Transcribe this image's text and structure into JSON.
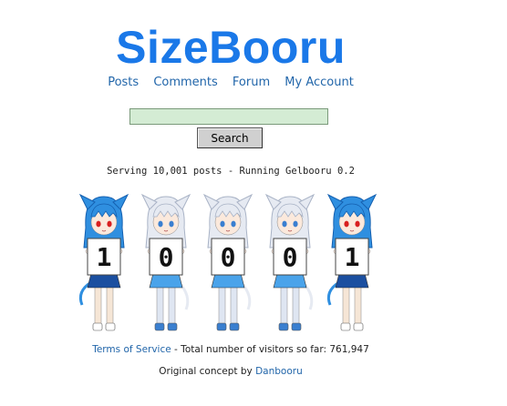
{
  "site": {
    "title": "SizeBooru",
    "title_color": "#1a78e8"
  },
  "nav": {
    "items": [
      {
        "label": "Posts"
      },
      {
        "label": "Comments"
      },
      {
        "label": "Forum"
      },
      {
        "label": "My Account"
      }
    ],
    "link_color": "#2266aa"
  },
  "search": {
    "value": "",
    "button_label": "Search",
    "field_color": "#d4ecd4"
  },
  "status": {
    "serving_text": "Serving 10,001 posts - Running Gelbooru 0.2"
  },
  "counter": {
    "digits": [
      {
        "value": "1",
        "character": "blue-hair"
      },
      {
        "value": "0",
        "character": "white-hair"
      },
      {
        "value": "0",
        "character": "white-hair"
      },
      {
        "value": "0",
        "character": "white-hair"
      },
      {
        "value": "1",
        "character": "blue-hair"
      }
    ],
    "colors": {
      "blue_hair": "#2f8fe0",
      "white_hair": "#e6eaf2"
    }
  },
  "footer": {
    "terms_label": "Terms of Service",
    "visitors_text": " - Total number of visitors so far: 761,947",
    "concept_prefix": "Original concept by ",
    "concept_link": "Danbooru"
  }
}
